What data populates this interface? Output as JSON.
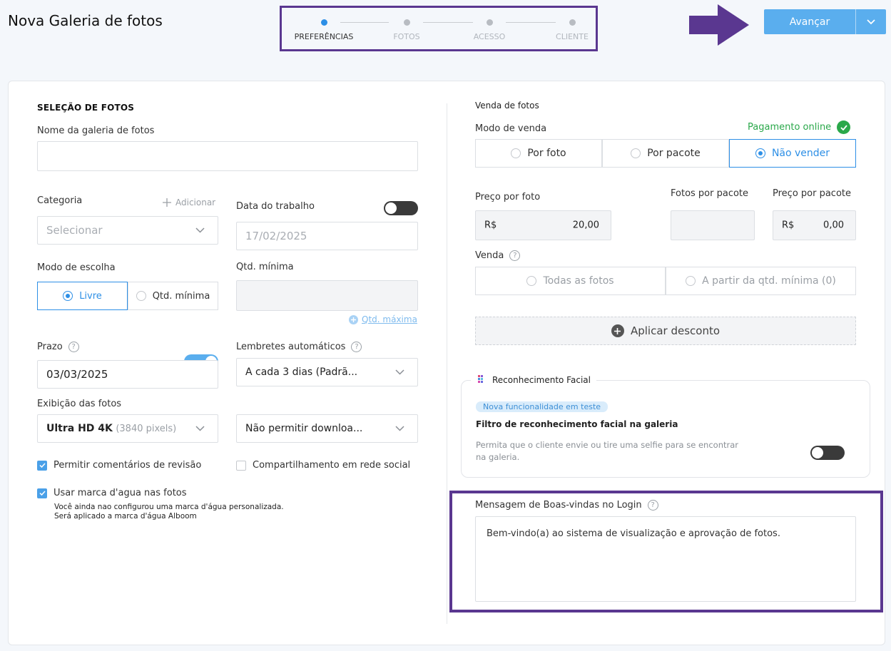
{
  "page": {
    "title": "Nova Galeria de fotos"
  },
  "stepper": {
    "steps": [
      {
        "label": "PREFERÊNCIAS",
        "active": true
      },
      {
        "label": "FOTOS",
        "active": false
      },
      {
        "label": "ACESSO",
        "active": false
      },
      {
        "label": "CLIENTE",
        "active": false
      }
    ]
  },
  "header": {
    "advance_label": "Avançar",
    "annotation_arrow_icon": "arrow-right-icon"
  },
  "colors": {
    "accent": "#2d8fe6",
    "button": "#5aaeee",
    "annotation": "#5a3790",
    "success": "#2aa84a"
  },
  "left": {
    "section_title": "SELEÇÃO DE FOTOS",
    "gallery_name": {
      "label": "Nome da galeria de fotos",
      "value": ""
    },
    "category": {
      "label": "Categoria",
      "add_label": "Adicionar",
      "placeholder": "Selecionar"
    },
    "work_date": {
      "label": "Data do trabalho",
      "value": "17/02/2025",
      "toggle_on": false
    },
    "choice_mode": {
      "label": "Modo de escolha",
      "options": [
        "Livre",
        "Qtd. mínima"
      ],
      "selected": "Livre"
    },
    "min_qty": {
      "label": "Qtd. mínima",
      "max_link": "Qtd. máxima"
    },
    "deadline": {
      "label": "Prazo",
      "value": "03/03/2025",
      "toggle_on": true
    },
    "reminders": {
      "label": "Lembretes automáticos",
      "value": "A cada 3 dias (Padrã..."
    },
    "display": {
      "label": "Exibição das fotos",
      "value": "Ultra HD 4K",
      "value_note": "(3840 pixels)",
      "download_value": "Não permitir downloa..."
    },
    "allow_comments": {
      "label": "Permitir comentários de revisão",
      "checked": true
    },
    "social_share": {
      "label": "Compartilhamento em rede social",
      "checked": false
    },
    "watermark": {
      "label": "Usar marca d'agua nas fotos",
      "checked": true,
      "note_line1": "Você ainda nao configurou uma marca d'água personalizada.",
      "note_line2": "Será aplicado a marca d'água Alboom"
    }
  },
  "right": {
    "section_title": "Venda de fotos",
    "sale_mode": {
      "label": "Modo de venda",
      "online_label": "Pagamento online",
      "options": [
        "Por foto",
        "Por pacote",
        "Não vender"
      ],
      "selected": "Não vender"
    },
    "price_per_photo": {
      "label": "Preço por foto",
      "currency": "R$",
      "value": "20,00"
    },
    "photos_per_package": {
      "label": "Fotos por pacote",
      "value": ""
    },
    "price_per_package": {
      "label": "Preço por pacote",
      "currency": "R$",
      "value": "0,00"
    },
    "sale": {
      "label": "Venda",
      "options": [
        "Todas as fotos",
        "A partir da qtd. mínima (0)"
      ]
    },
    "discount_label": "Aplicar desconto",
    "facial": {
      "title": "Reconhecimento Facial",
      "badge": "Nova funcionalidade em teste",
      "filter_label": "Filtro de reconhecimento facial na galeria",
      "desc_line1": "Permita que o cliente envie ou tire uma selfie para se encontrar",
      "desc_line2": "na galeria.",
      "toggle_on": false
    },
    "welcome": {
      "label": "Mensagem de Boas-vindas no Login",
      "value": "Bem-vindo(a) ao sistema de visualização e aprovação de fotos."
    }
  }
}
